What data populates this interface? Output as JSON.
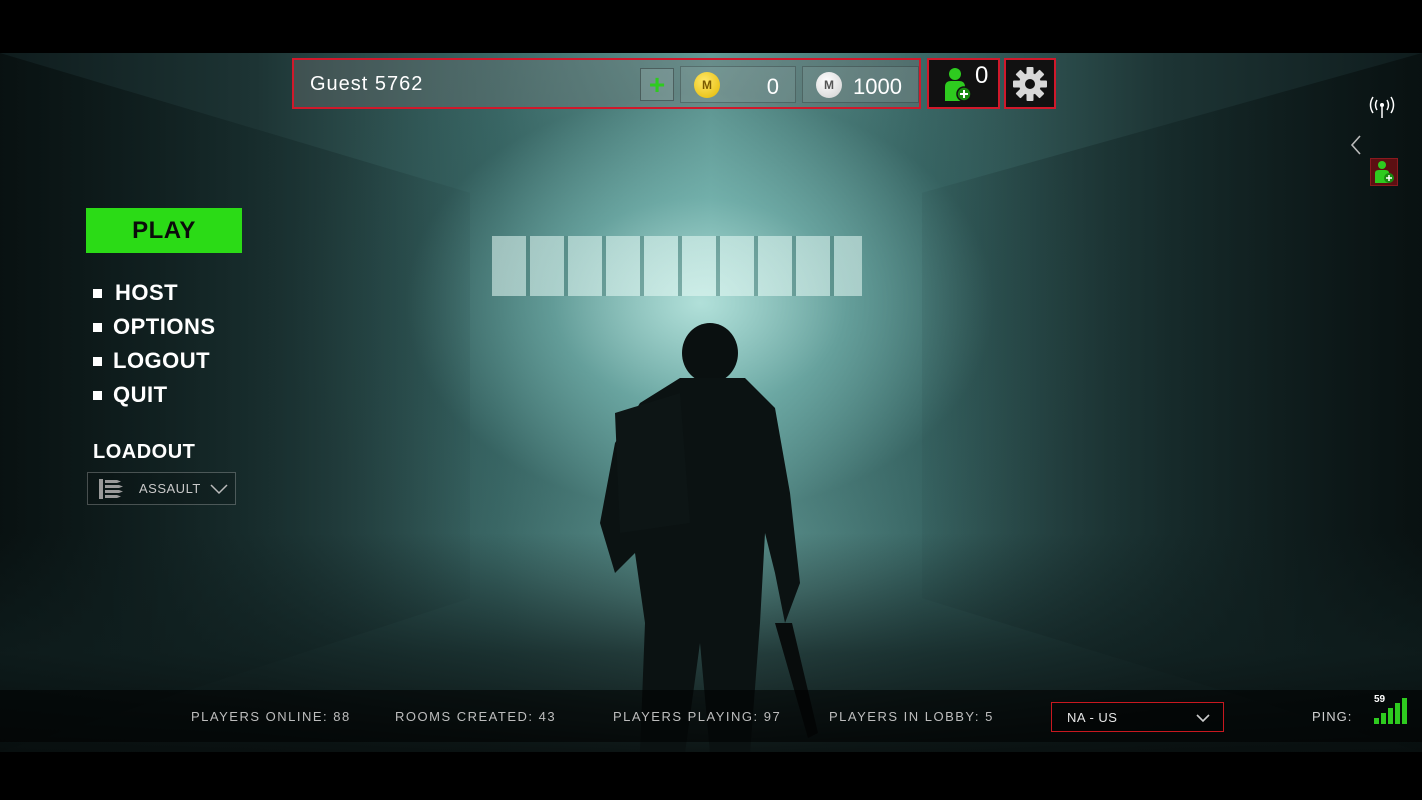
{
  "profile": {
    "name": "Guest 5762",
    "add_label": "+",
    "gold": {
      "symbol": "M",
      "amount": "0"
    },
    "silver": {
      "symbol": "M",
      "amount": "1000"
    }
  },
  "friends": {
    "count": "0"
  },
  "menu": {
    "play": "PLAY",
    "items": [
      "HOST",
      "OPTIONS",
      "LOGOUT",
      "QUIT"
    ]
  },
  "loadout": {
    "title": "LOADOUT",
    "selected": "ASSAULT"
  },
  "status": {
    "players_online": "PLAYERS ONLINE: 88",
    "rooms_created": "ROOMS CREATED: 43",
    "players_playing": "PLAYERS PLAYING: 97",
    "players_in_lobby": "PLAYERS IN LOBBY: 5",
    "region": "NA - US",
    "ping_label": "PING:",
    "ping_value": "59",
    "ping_strength": 1.0
  },
  "colors": {
    "play_green": "#2bdb16",
    "frame_red": "#d0192b",
    "friend_green": "#2ecb1f"
  },
  "icons": [
    "plus-icon",
    "gold-coin-icon",
    "silver-coin-icon",
    "add-friend-icon",
    "gear-icon",
    "signal-icon",
    "chevron-left-icon",
    "ammo-icon",
    "chevron-down-icon",
    "ping-bars-icon"
  ]
}
